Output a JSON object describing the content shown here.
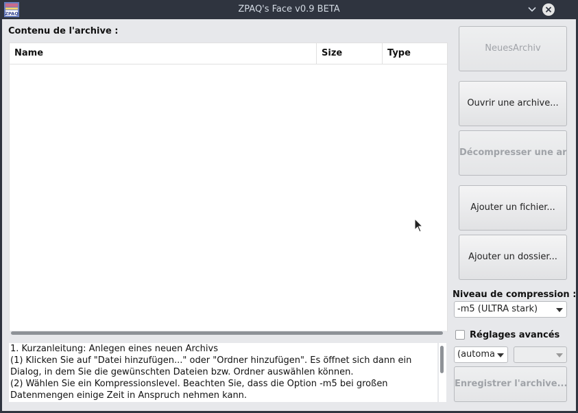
{
  "window": {
    "title": "ZPAQ's Face v0.9 BETA",
    "icon_text": "ZPAQ"
  },
  "archive": {
    "label": "Contenu de l'archive :",
    "columns": [
      "Name",
      "Size",
      "Type"
    ]
  },
  "buttons": {
    "new": "NeuesArchiv",
    "open": "Ouvrir une archive...",
    "decompress": "Décompresser une ar",
    "add_file": "Ajouter un fichier...",
    "add_folder": "Ajouter un dossier...",
    "save": "Enregistrer l'archive..."
  },
  "compression": {
    "label": "Niveau de compression :",
    "selected": "-m5 (ULTRA stark)"
  },
  "advanced": {
    "label": "Réglages avancés",
    "checked": false,
    "option1": "(automa",
    "option2": ""
  },
  "log": {
    "lines": [
      "1. Kurzanleitung: Anlegen eines neuen Archivs",
      "(1) Klicken Sie auf \"Datei hinzufügen...\" oder \"Ordner hinzufügen\". Es öffnet sich dann ein",
      "Dialog, in dem Sie die gewünschten Dateien bzw. Ordner auswählen können.",
      "(2) Wählen Sie ein Kompressionslevel. Beachten Sie, dass die Option -m5 bei großen",
      "Datenmengen einige Zeit in Anspruch nehmen kann."
    ]
  }
}
